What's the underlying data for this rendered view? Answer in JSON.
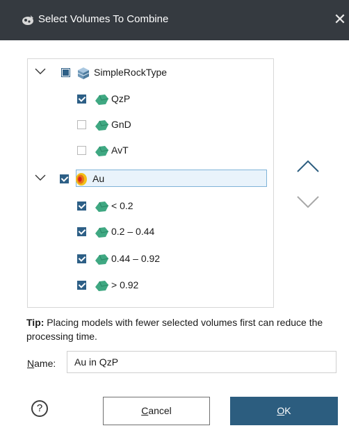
{
  "window": {
    "title": "Select Volumes To Combine",
    "close_glyph": "✕"
  },
  "tree": [
    {
      "label": "SimpleRockType",
      "icon": "geological-model-icon",
      "state": "partial",
      "expanded": true,
      "level": 0
    },
    {
      "label": "QzP",
      "icon": "volume-icon",
      "state": "checked",
      "level": 1
    },
    {
      "label": "GnD",
      "icon": "volume-icon",
      "state": "unchecked",
      "level": 1
    },
    {
      "label": "AvT",
      "icon": "volume-icon",
      "state": "unchecked",
      "level": 1
    },
    {
      "label": "Au",
      "icon": "numeric-model-icon",
      "state": "checked",
      "expanded": true,
      "selected": true,
      "level": 0
    },
    {
      "label": "< 0.2",
      "icon": "volume-icon",
      "state": "checked",
      "level": 1
    },
    {
      "label": "0.2 – 0.44",
      "icon": "volume-icon",
      "state": "checked",
      "level": 1
    },
    {
      "label": "0.44 – 0.92",
      "icon": "volume-icon",
      "state": "checked",
      "level": 1
    },
    {
      "label": "> 0.92",
      "icon": "volume-icon",
      "state": "checked",
      "level": 1
    }
  ],
  "tip": {
    "bold": "Tip:",
    "text": " Placing models with fewer selected volumes first can reduce the processing time."
  },
  "name_field": {
    "label_first": "N",
    "label_rest": "ame:",
    "value": "Au in QzP"
  },
  "buttons": {
    "help": "?",
    "cancel_first": "C",
    "cancel_rest": "ancel",
    "ok_first": "O",
    "ok_rest": "K"
  },
  "colors": {
    "accent": "#2c5d7f",
    "titlebar": "#353a40",
    "volume_green": "#3fa882",
    "selection": "#e9f3fb"
  }
}
